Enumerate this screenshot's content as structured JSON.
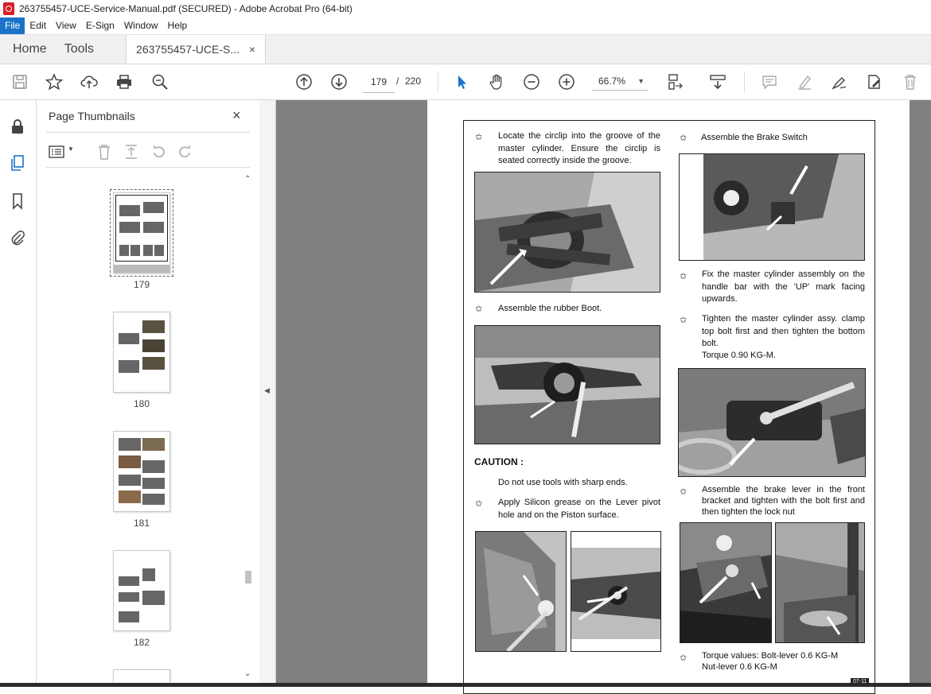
{
  "window": {
    "title": "263755457-UCE-Service-Manual.pdf (SECURED) - Adobe Acrobat Pro (64-bit)"
  },
  "menu": [
    "File",
    "Edit",
    "View",
    "E-Sign",
    "Window",
    "Help"
  ],
  "tabs": {
    "home": "Home",
    "tools": "Tools",
    "doc": "263755457-UCE-S...",
    "doc_close": "×"
  },
  "toolbar": {
    "page_current": "179",
    "page_sep": "/",
    "page_total": "220",
    "zoom": "66.7%"
  },
  "panel": {
    "title": "Page Thumbnails",
    "close": "×",
    "thumbnails": [
      {
        "label": "179"
      },
      {
        "label": "180"
      },
      {
        "label": "181"
      },
      {
        "label": "182"
      }
    ]
  },
  "document": {
    "left": {
      "step1": "Locate the circlip into the groove of the master cylinder. Ensure the circlip is seated correctly inside the groove.",
      "step2": "Assemble the rubber Boot.",
      "caution_title": "CAUTION :",
      "caution_text": "Do not use tools with sharp ends.",
      "step3": "Apply Silicon grease on the Lever pivot hole and on the Piston surface."
    },
    "right": {
      "step1": "Assemble the Brake Switch",
      "step2": "Fix the master cylinder assembly on the handle bar with the 'UP' mark facing upwards.",
      "step3_line1": "Tighten the master cylinder assy. clamp top bolt first and then tighten the bottom bolt.",
      "step3_line2": "Torque 0.90 KG-M.",
      "step4": "Assemble the brake lever in the front bracket and tighten with the bolt first and then tighten the lock nut",
      "step5_line1": "Torque values: Bolt-lever 0.6 KG-M",
      "step5_line2": "Nut-lever 0.6 KG-M"
    },
    "bullet": "✩",
    "page_tag": "07-11"
  },
  "icons": [
    "save-icon",
    "star-icon",
    "upload-icon",
    "print-icon",
    "zoom-search-icon",
    "arrow-up-icon",
    "arrow-down-icon",
    "cursor-icon",
    "hand-icon",
    "zoom-out-icon",
    "zoom-in-icon",
    "fit-page-icon",
    "scroll-mode-icon",
    "comment-icon",
    "highlight-icon",
    "sign-icon",
    "edit-pdf-icon",
    "delete-icon",
    "lock-icon",
    "pages-icon",
    "bookmark-icon",
    "attachment-icon"
  ]
}
